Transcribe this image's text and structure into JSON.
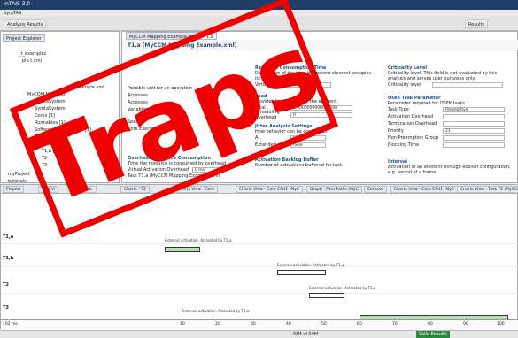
{
  "titlebar": {
    "title": "mTAIS 3.0"
  },
  "menubar": {
    "items": [
      "SymTAS"
    ]
  },
  "toolbar": {
    "left_label": "Analysis Results",
    "right_label": "Results"
  },
  "leftpanel": {
    "tab": "Project Explorer",
    "tree": [
      "_t_examples",
      "ple.t.xml",
      "MyCOM Mapping",
      "SymtaSystem",
      "SymtaSystem",
      "Cores [1]",
      "Runnables [1]",
      "Software Components [1]",
      "Tasks [8]",
      "T1,a [CPU]",
      "T1,b [CPU]",
      "T2",
      "T3",
      "myProject",
      "tutorials"
    ],
    "xml_label": "...ing Example.xml"
  },
  "editor": {
    "tabs": [
      "MyCCM Mapping Example.xml",
      "T1,a"
    ],
    "header": "T1,a (MyCCM Mapping Example.xml)",
    "resource_consumption": {
      "title": "Resource Consumption Time",
      "desc": "Description of the time the parent element occupies its resource.",
      "label": "Virtual TCore",
      "value": "[3 ms;10 ms]"
    },
    "load": {
      "title": "Load",
      "desc": "Provides load results for the element.",
      "total_label": "Total",
      "total_value": "0.0000000000000000",
      "sched_label": "Scheduling Overhead",
      "sched_value": "0"
    },
    "jitter": {
      "title": "Jitter Analysis Settings",
      "desc": "How behavior can be configured",
      "a_label": "A",
      "a_value": "true",
      "ext_label": "Extended",
      "ext_value": "false"
    },
    "activation": {
      "title": "Activation Backlog Buffer",
      "desc": "Number of activations buffered for task"
    },
    "overhead": {
      "title": "Overhead Resource Consumption",
      "desc": "Time the resource is consumed by overhead",
      "row1_label": "Virtual Activation Overhead",
      "row1_value": "0 ms",
      "row2_label": "Task T1,a (MyCCM Mapping Example.xml)"
    },
    "left_fields": [
      "Possible unit for an operation",
      "Accesses",
      "Accesses",
      "Variables",
      "Specific",
      "Core Execution"
    ],
    "criticality": {
      "title": "Criticality Level",
      "desc": "Criticality level. This field is not evaluated by this analysis and serves user purposes only.",
      "label": "Criticality level"
    },
    "osek": {
      "title": "Osek Task Parameter",
      "desc": "Parameter required for OSEK tasks",
      "rows": [
        {
          "label": "Task Type",
          "value": "Preemptive"
        },
        {
          "label": "Activation Overhead",
          "value": ""
        },
        {
          "label": "Termination Overhead",
          "value": ""
        },
        {
          "label": "Priority",
          "value": "21"
        },
        {
          "label": "Non Preemption Group",
          "value": ""
        },
        {
          "label": "Blocking Time",
          "value": ""
        }
      ]
    },
    "interval": {
      "title": "Interval",
      "desc": "Activation of an element through explicit configuration, e.g. period of a frame."
    }
  },
  "bottom": {
    "left_tabs": [
      "Propert",
      "Tree Vi",
      "Graphic"
    ],
    "tabs": [
      "Charts - T2",
      "Charts View - Core",
      "Charts View - Core CPU1 (MyC",
      "Graph - Path Paths (MyC",
      "Console",
      "Charts View - Core CPU1 (MyC",
      "Charts View - Task T2 (MyCCM"
    ],
    "lanes": [
      "T1,a",
      "T1,b",
      "T2",
      "T3"
    ],
    "annotations": [
      "External activation. Activated by T1,a.",
      "External activation. Activated by T1,a.",
      "External activation. Activated by T1,a.",
      "External activation. Activated by T1,a."
    ],
    "wcrt_label": "wcrt: 102 ms",
    "axis": {
      "unit": "102 ms",
      "ticks": [
        "10",
        "20",
        "30",
        "40",
        "50",
        "60",
        "70",
        "80",
        "90",
        "100"
      ]
    }
  },
  "status": {
    "left": "",
    "middle": "40M of 59M",
    "right": "Valid Results"
  },
  "stamp": {
    "text": "Traps"
  }
}
